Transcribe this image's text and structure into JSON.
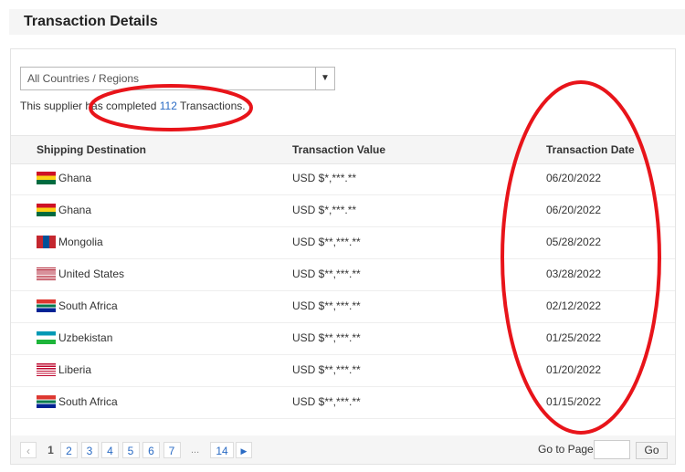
{
  "title": "Transaction Details",
  "filter": {
    "selected": "All Countries / Regions"
  },
  "summary": {
    "prefix": "This supplier has completed ",
    "count": "112",
    "suffix": " Transactions."
  },
  "columns": [
    "Shipping Destination",
    "Transaction Value",
    "Transaction Date"
  ],
  "rows": [
    {
      "country": "Ghana",
      "flag": "ghana",
      "value": "USD $*,***.**",
      "date": "06/20/2022"
    },
    {
      "country": "Ghana",
      "flag": "ghana",
      "value": "USD $*,***.**",
      "date": "06/20/2022"
    },
    {
      "country": "Mongolia",
      "flag": "mongolia",
      "value": "USD $**,***.**",
      "date": "05/28/2022"
    },
    {
      "country": "United States",
      "flag": "us",
      "value": "USD $**,***.**",
      "date": "03/28/2022"
    },
    {
      "country": "South Africa",
      "flag": "za",
      "value": "USD $**,***.**",
      "date": "02/12/2022"
    },
    {
      "country": "Uzbekistan",
      "flag": "uz",
      "value": "USD $**,***.**",
      "date": "01/25/2022"
    },
    {
      "country": "Liberia",
      "flag": "lr",
      "value": "USD $**,***.**",
      "date": "01/20/2022"
    },
    {
      "country": "South Africa",
      "flag": "za",
      "value": "USD $**,***.**",
      "date": "01/15/2022"
    }
  ],
  "pagination": {
    "pages": [
      "1",
      "2",
      "3",
      "4",
      "5",
      "6",
      "7"
    ],
    "ellipsis": "...",
    "last": "14",
    "goto_label": "Go to Page",
    "go_label": "Go"
  },
  "annotation_color": "#e8141a"
}
